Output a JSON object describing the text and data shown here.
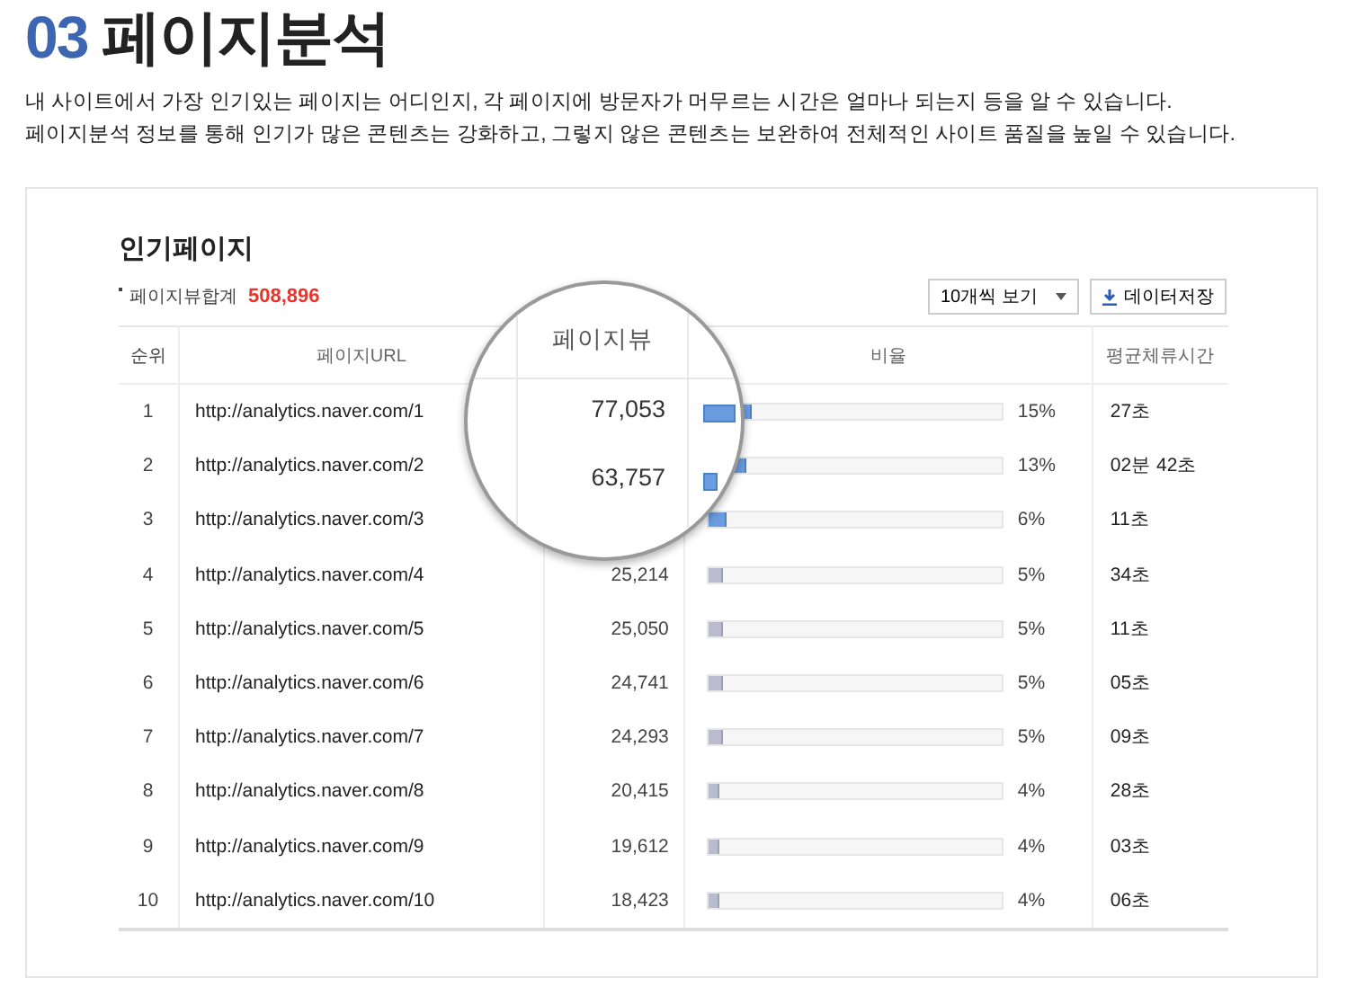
{
  "heading": {
    "number": "03",
    "title": "페이지분석"
  },
  "description": [
    "내 사이트에서 가장 인기있는 페이지는 어디인지, 각 페이지에 방문자가 머무르는 시간은 얼마나 되는지 등을 알 수 있습니다.",
    "페이지분석 정보를 통해 인기가 많은 콘텐츠는 강화하고, 그렇지 않은 콘텐츠는 보완하여 전체적인 사이트 품질을 높일 수 있습니다."
  ],
  "panel": {
    "title": "인기페이지",
    "total_label": "페이지뷰합계",
    "total_value": "508,896",
    "page_size": "10개씩 보기",
    "save_button": "데이터저장",
    "table": {
      "columns": [
        "순위",
        "페이지URL",
        "",
        "비율",
        "평균체류시간"
      ],
      "rows": [
        {
          "rank": "1",
          "url": "http://analytics.naver.com/1",
          "level": 0.15,
          "highlighted": true,
          "ratio": "15%",
          "time": "27초"
        },
        {
          "rank": "2",
          "url": "http://analytics.naver.com/2",
          "level": 0.13,
          "highlighted": true,
          "ratio": "13%",
          "time": "02분 42초"
        },
        {
          "rank": "3",
          "url": "http://analytics.naver.com/3",
          "level": 0.06,
          "highlighted": true,
          "ratio": "6%",
          "time": "11초"
        },
        {
          "rank": "4",
          "url": "http://analytics.naver.com/4",
          "page_views": "25,214",
          "level": 0.05,
          "highlighted": false,
          "ratio": "5%",
          "time": "34초"
        },
        {
          "rank": "5",
          "url": "http://analytics.naver.com/5",
          "page_views": "25,050",
          "level": 0.05,
          "highlighted": false,
          "ratio": "5%",
          "time": "11초"
        },
        {
          "rank": "6",
          "url": "http://analytics.naver.com/6",
          "page_views": "24,741",
          "level": 0.05,
          "highlighted": false,
          "ratio": "5%",
          "time": "05초"
        },
        {
          "rank": "7",
          "url": "http://analytics.naver.com/7",
          "page_views": "24,293",
          "level": 0.05,
          "highlighted": false,
          "ratio": "5%",
          "time": "09초"
        },
        {
          "rank": "8",
          "url": "http://analytics.naver.com/8",
          "page_views": "20,415",
          "level": 0.04,
          "highlighted": false,
          "ratio": "4%",
          "time": "28초"
        },
        {
          "rank": "9",
          "url": "http://analytics.naver.com/9",
          "page_views": "19,612",
          "level": 0.04,
          "highlighted": false,
          "ratio": "4%",
          "time": "03초"
        },
        {
          "rank": "10",
          "url": "http://analytics.naver.com/10",
          "page_views": "18,423",
          "level": 0.04,
          "highlighted": false,
          "ratio": "4%",
          "time": "06초"
        }
      ]
    },
    "magnifier": {
      "header": "페이지뷰",
      "values": [
        "77,053",
        "63,757"
      ]
    }
  }
}
